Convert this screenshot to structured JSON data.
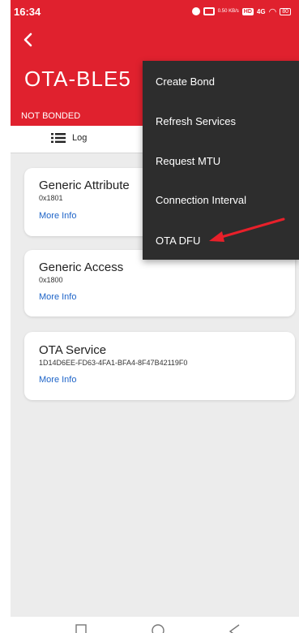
{
  "status_bar": {
    "time": "16:34",
    "speed": "0.50\nKB/s",
    "hd": "HD",
    "network": "4G",
    "battery": "80"
  },
  "header": {
    "back_icon": "chevron-left-icon",
    "device_name": "OTA-BLE5",
    "bond_status": "NOT BONDED"
  },
  "tabs": {
    "log_label": "Log"
  },
  "services": [
    {
      "name": "Generic Attribute",
      "uuid": "0x1801",
      "more": "More Info"
    },
    {
      "name": "Generic Access",
      "uuid": "0x1800",
      "more": "More Info"
    },
    {
      "name": "OTA Service",
      "uuid": "1D14D6EE-FD63-4FA1-BFA4-8F47B42119F0",
      "more": "More Info"
    }
  ],
  "menu": {
    "items": [
      "Create Bond",
      "Refresh Services",
      "Request MTU",
      "Connection Interval",
      "OTA DFU"
    ]
  },
  "colors": {
    "header_bg": "#e0212e",
    "menu_bg": "#2d2d2d",
    "link": "#1e64c8",
    "arrow": "#e8202a"
  }
}
